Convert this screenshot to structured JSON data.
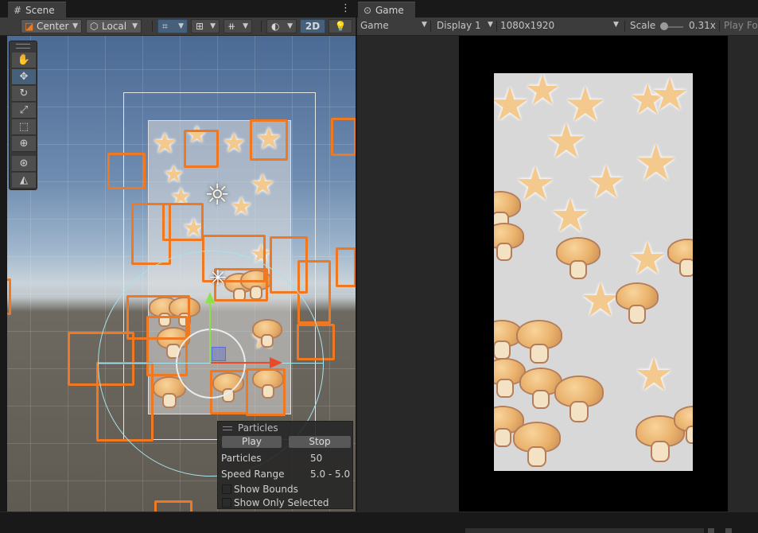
{
  "scene_tab": {
    "label": "Scene",
    "icon": "grid-icon"
  },
  "game_tab": {
    "label": "Game",
    "icon": "gamepad-icon"
  },
  "scene_toolbar": {
    "pivot_label": "Center",
    "space_label": "Local",
    "mode_2d_label": "2D"
  },
  "game_toolbar": {
    "view_select": "Game",
    "display_select": "Display 1",
    "resolution_select": "1080x1920",
    "scale_label": "Scale",
    "scale_value": "0.31x",
    "play_focused_label": "Play Fo"
  },
  "particles_panel": {
    "title": "Particles",
    "play_label": "Play",
    "stop_label": "Stop",
    "particles_label": "Particles",
    "particles_value": "50",
    "speed_range_label": "Speed Range",
    "speed_range_value": "5.0 - 5.0",
    "show_bounds_label": "Show Bounds",
    "show_only_selected_label": "Show Only Selected"
  },
  "colors": {
    "accent": "#46607c",
    "bounds_orange": "#f07820",
    "panel_bg": "#3c3c3c"
  }
}
